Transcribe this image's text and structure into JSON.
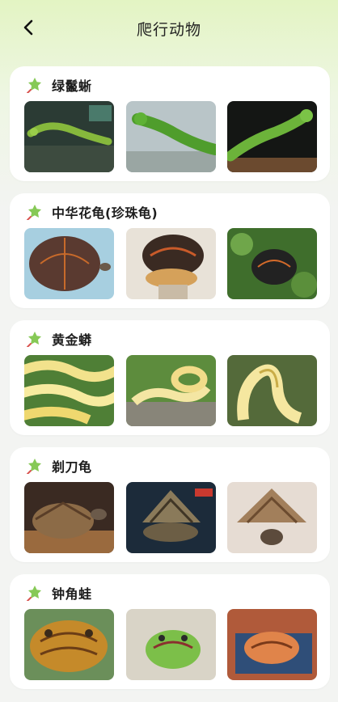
{
  "header": {
    "title": "爬行动物",
    "back_icon": "back-arrow-icon"
  },
  "categories": [
    {
      "name": "绿鬣蜥",
      "photos": [
        "green-iguana-photo-1",
        "green-iguana-photo-2",
        "green-iguana-photo-3"
      ]
    },
    {
      "name": "中华花龟(珍珠龟)",
      "photos": [
        "chinese-stripe-turtle-photo-1",
        "chinese-stripe-turtle-photo-2",
        "chinese-stripe-turtle-photo-3"
      ]
    },
    {
      "name": "黄金蟒",
      "photos": [
        "golden-python-photo-1",
        "golden-python-photo-2",
        "golden-python-photo-3"
      ]
    },
    {
      "name": "剃刀龟",
      "photos": [
        "razorback-musk-turtle-photo-1",
        "razorback-musk-turtle-photo-2",
        "razorback-musk-turtle-photo-3"
      ]
    },
    {
      "name": "钟角蛙",
      "photos": [
        "horned-frog-photo-1",
        "horned-frog-photo-2",
        "horned-frog-photo-3"
      ]
    }
  ],
  "colors": {
    "accent": "#8fd14f",
    "card_bg": "#ffffff",
    "header_bg": "#e3f4c3"
  }
}
